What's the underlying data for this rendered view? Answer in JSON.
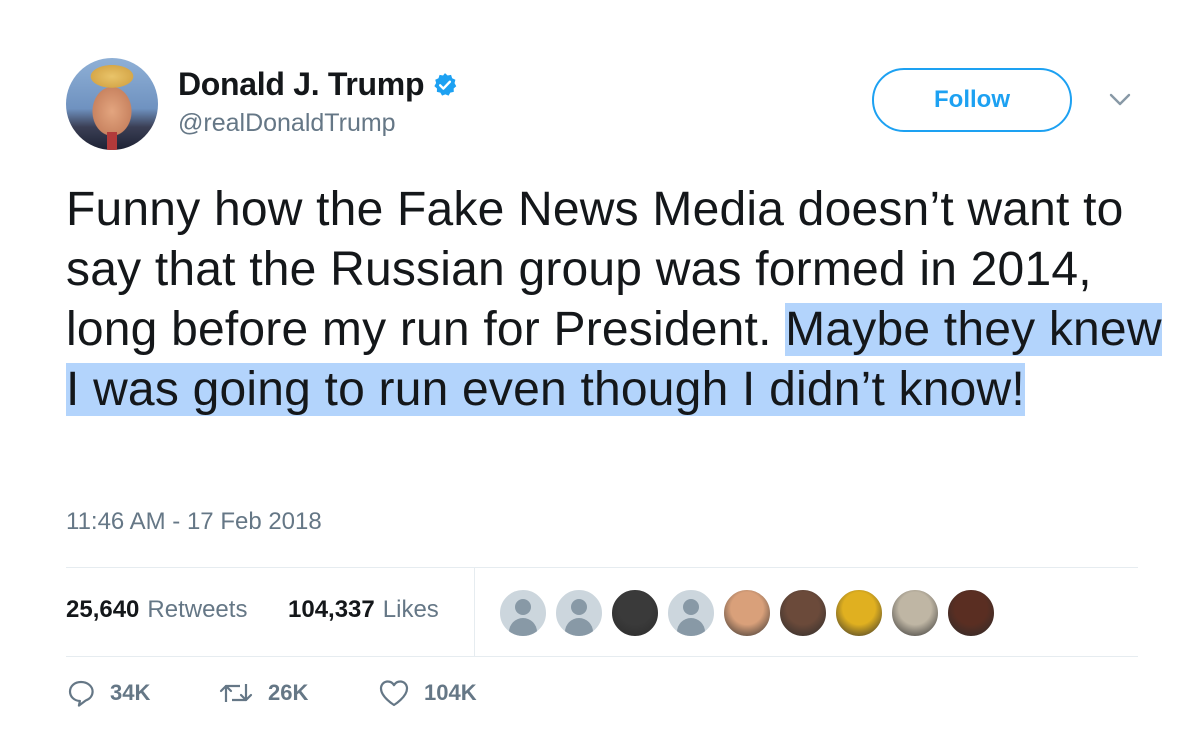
{
  "author": {
    "display_name": "Donald J. Trump",
    "handle": "@realDonaldTrump",
    "verified": true
  },
  "follow_button": {
    "label": "Follow"
  },
  "tweet": {
    "text_plain": "Funny how the Fake News Media doesn’t want to say that the Russian group was formed in 2014, long before my run for President. ",
    "text_highlighted": "Maybe they knew I was going to run even though I didn’t know!",
    "timestamp": "11:46 AM - 17 Feb 2018"
  },
  "stats": {
    "retweets_count": "25,640",
    "retweets_label": "Retweets",
    "likes_count": "104,337",
    "likes_label": "Likes"
  },
  "likers": [
    {
      "type": "default"
    },
    {
      "type": "default"
    },
    {
      "type": "photo",
      "color": "#3a3a3a"
    },
    {
      "type": "default"
    },
    {
      "type": "photo",
      "color": "#d9a07a"
    },
    {
      "type": "photo",
      "color": "#6b4a3a"
    },
    {
      "type": "photo",
      "color": "#e0b020"
    },
    {
      "type": "photo",
      "color": "#bfb6a4"
    },
    {
      "type": "photo",
      "color": "#5a2e22"
    }
  ],
  "actions": {
    "replies": "34K",
    "retweets": "26K",
    "likes": "104K"
  },
  "colors": {
    "accent": "#1da1f2",
    "secondary_text": "#657786",
    "highlight": "#b3d4fc"
  }
}
